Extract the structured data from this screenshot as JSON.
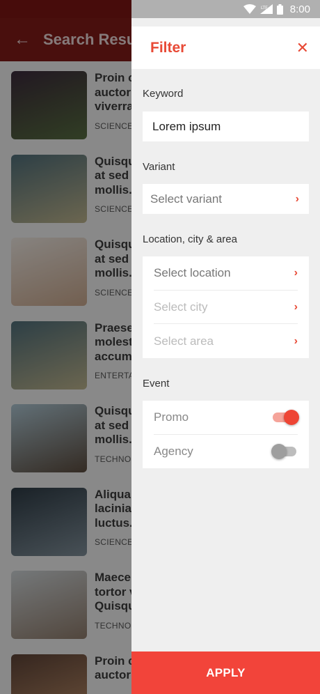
{
  "status": {
    "time": "8:00",
    "network": "LTE"
  },
  "app_bar": {
    "title": "Search Results",
    "back_icon": "arrow-left-icon"
  },
  "results": [
    {
      "lines": [
        "Proin c",
        "auctor",
        "viverra"
      ],
      "category": "SCIENCE",
      "thumb_colors": [
        "#3b2a3b",
        "#556b3e"
      ]
    },
    {
      "lines": [
        "Quisqu",
        "at sed",
        "mollis."
      ],
      "category": "SCIENCE",
      "thumb_colors": [
        "#4f6d78",
        "#b9b08a"
      ]
    },
    {
      "lines": [
        "Quisqu",
        "at sed",
        "mollis."
      ],
      "category": "SCIENCE",
      "thumb_colors": [
        "#e8e2dc",
        "#c5a48a"
      ]
    },
    {
      "lines": [
        "Praese",
        "molest",
        "accum"
      ],
      "category": "ENTERTA",
      "thumb_colors": [
        "#4f6d78",
        "#b9b08a"
      ]
    },
    {
      "lines": [
        "Quisqu",
        "at sed",
        "mollis."
      ],
      "category": "TECHNO",
      "thumb_colors": [
        "#a9c1cd",
        "#5a4b3e"
      ]
    },
    {
      "lines": [
        "Aliquar",
        "lacinia",
        "luctus."
      ],
      "category": "SCIENCE",
      "thumb_colors": [
        "#2d3a44",
        "#7d8c96"
      ]
    },
    {
      "lines": [
        "Maece",
        "tortor v",
        "Quisqu"
      ],
      "category": "TECHNO",
      "thumb_colors": [
        "#c9cfd2",
        "#8d7a6a"
      ]
    },
    {
      "lines": [
        "Proin c",
        "auctor",
        ""
      ],
      "category": "",
      "thumb_colors": [
        "#5c4236",
        "#b98b66"
      ]
    }
  ],
  "filter": {
    "title": "Filter",
    "close_icon": "close-icon",
    "keyword": {
      "label": "Keyword",
      "value": "Lorem ipsum"
    },
    "variant": {
      "label": "Variant",
      "placeholder": "Select variant"
    },
    "location": {
      "label": "Location, city & area",
      "rows": [
        "Select location",
        "Select city",
        "Select area"
      ]
    },
    "event": {
      "label": "Event",
      "rows": [
        {
          "label": "Promo",
          "enabled": true
        },
        {
          "label": "Agency",
          "enabled": false
        }
      ]
    },
    "apply_label": "APPLY"
  },
  "colors": {
    "accent": "#e84a36",
    "apply_bg": "#f2443a",
    "app_bar": "#c62828"
  }
}
